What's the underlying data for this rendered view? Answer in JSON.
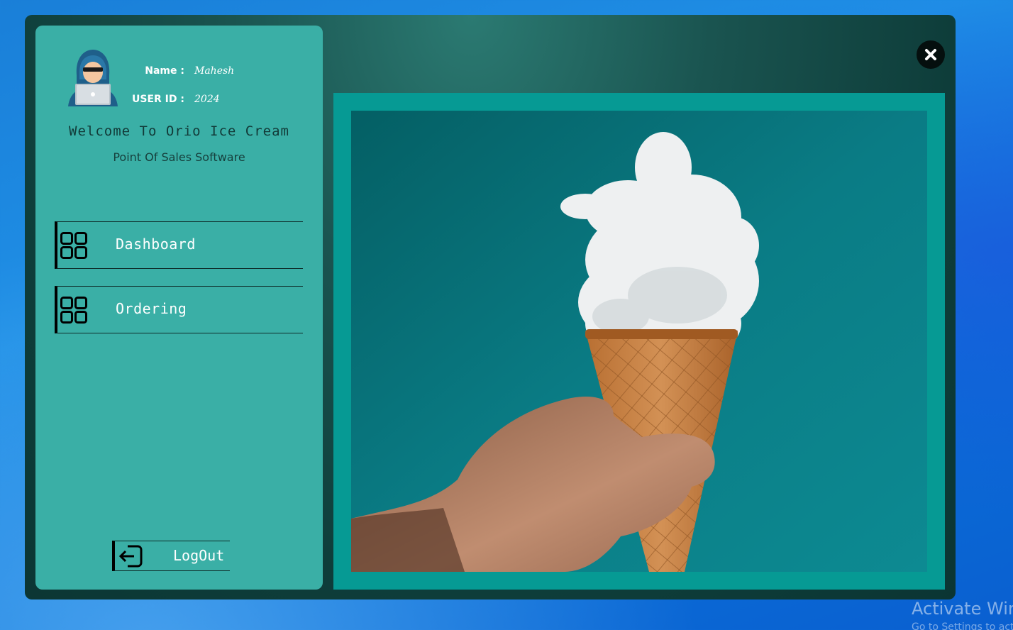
{
  "user": {
    "name_label": "Name :",
    "name_value": "Mahesh",
    "id_label": "USER ID :",
    "id_value": "2024"
  },
  "header": {
    "welcome": "Welcome To Orio Ice Cream",
    "subtitle": "Point Of Sales Software"
  },
  "nav": {
    "items": [
      {
        "label": "Dashboard",
        "icon": "grid-icon"
      },
      {
        "label": "Ordering",
        "icon": "grid-icon"
      }
    ],
    "logout_label": "LogOut",
    "logout_icon": "logout-icon"
  },
  "window": {
    "close_icon": "close-icon"
  },
  "hero": {
    "description_icon": "ice-cream-cloud-photo"
  },
  "colors": {
    "sidebar": "#3aafa6",
    "frame": "#069a94",
    "window": "#0e3d3a",
    "text_dark": "#123a38"
  },
  "os": {
    "watermark": "Activate Windows",
    "watermark_sub": "Go to Settings to activate Windows."
  }
}
